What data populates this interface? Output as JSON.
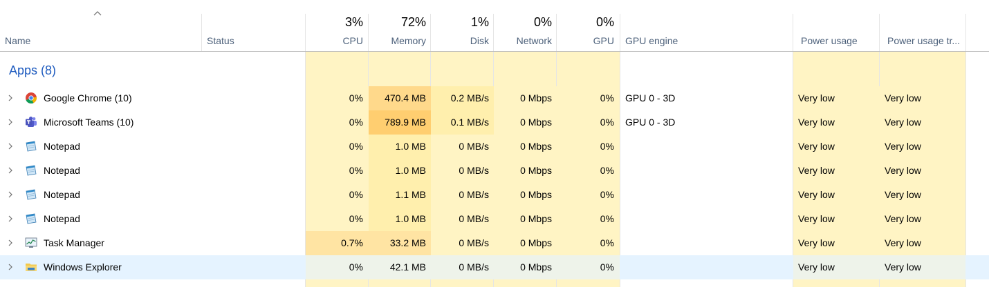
{
  "header": {
    "name_label": "Name",
    "status_label": "Status",
    "cpu": {
      "pct": "3%",
      "label": "CPU"
    },
    "memory": {
      "pct": "72%",
      "label": "Memory"
    },
    "disk": {
      "pct": "1%",
      "label": "Disk"
    },
    "network": {
      "pct": "0%",
      "label": "Network"
    },
    "gpu": {
      "pct": "0%",
      "label": "GPU"
    },
    "gpu_engine_label": "GPU engine",
    "power_label": "Power usage",
    "power_trend_label": "Power usage tr..."
  },
  "group": {
    "title": "Apps (8)"
  },
  "rows": [
    {
      "name": "Google Chrome (10)",
      "icon": "chrome-icon",
      "cpu": "0%",
      "memory": "470.4 MB",
      "disk": "0.2 MB/s",
      "network": "0 Mbps",
      "gpu": "0%",
      "gpu_engine": "GPU 0 - 3D",
      "power": "Very low",
      "power_trend": "Very low"
    },
    {
      "name": "Microsoft Teams (10)",
      "icon": "teams-icon",
      "cpu": "0%",
      "memory": "789.9 MB",
      "disk": "0.1 MB/s",
      "network": "0 Mbps",
      "gpu": "0%",
      "gpu_engine": "GPU 0 - 3D",
      "power": "Very low",
      "power_trend": "Very low"
    },
    {
      "name": "Notepad",
      "icon": "notepad-icon",
      "cpu": "0%",
      "memory": "1.0 MB",
      "disk": "0 MB/s",
      "network": "0 Mbps",
      "gpu": "0%",
      "gpu_engine": "",
      "power": "Very low",
      "power_trend": "Very low"
    },
    {
      "name": "Notepad",
      "icon": "notepad-icon",
      "cpu": "0%",
      "memory": "1.0 MB",
      "disk": "0 MB/s",
      "network": "0 Mbps",
      "gpu": "0%",
      "gpu_engine": "",
      "power": "Very low",
      "power_trend": "Very low"
    },
    {
      "name": "Notepad",
      "icon": "notepad-icon",
      "cpu": "0%",
      "memory": "1.1 MB",
      "disk": "0 MB/s",
      "network": "0 Mbps",
      "gpu": "0%",
      "gpu_engine": "",
      "power": "Very low",
      "power_trend": "Very low"
    },
    {
      "name": "Notepad",
      "icon": "notepad-icon",
      "cpu": "0%",
      "memory": "1.0 MB",
      "disk": "0 MB/s",
      "network": "0 Mbps",
      "gpu": "0%",
      "gpu_engine": "",
      "power": "Very low",
      "power_trend": "Very low"
    },
    {
      "name": "Task Manager",
      "icon": "task-manager-icon",
      "cpu": "0.7%",
      "memory": "33.2 MB",
      "disk": "0 MB/s",
      "network": "0 Mbps",
      "gpu": "0%",
      "gpu_engine": "",
      "power": "Very low",
      "power_trend": "Very low"
    },
    {
      "name": "Windows Explorer",
      "icon": "folder-icon",
      "cpu": "0%",
      "memory": "42.1 MB",
      "disk": "0 MB/s",
      "network": "0 Mbps",
      "gpu": "0%",
      "gpu_engine": "",
      "power": "Very low",
      "power_trend": "Very low"
    }
  ],
  "colors": {
    "heat_base": "#fff4c4",
    "heat_light": "#ffefad",
    "heat_med": "#ffe4a3",
    "heat_strong": "#ffd98b",
    "heat_max": "#ffce70",
    "group_title": "#1e5bbf",
    "header_label": "#4c607a",
    "selected_row": "#e5f3ff"
  }
}
